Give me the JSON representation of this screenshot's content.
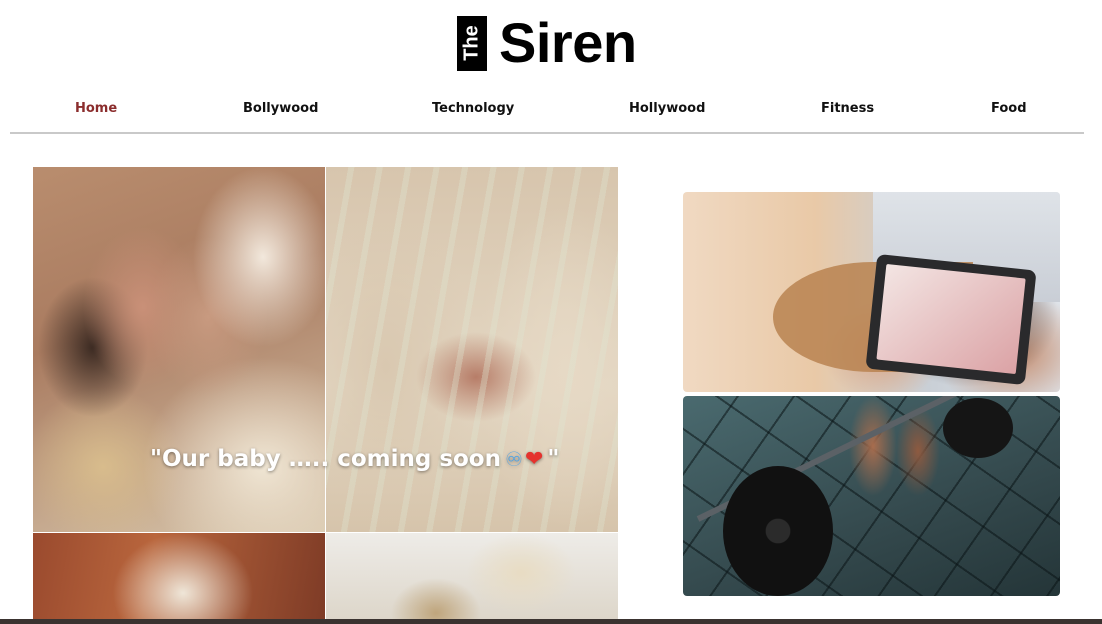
{
  "site": {
    "logo_badge": "The",
    "logo_text": "Siren",
    "accent_color": "#8b2d2d"
  },
  "nav": {
    "items": [
      {
        "label": "Home",
        "active": true
      },
      {
        "label": "Bollywood",
        "active": false
      },
      {
        "label": "Technology",
        "active": false
      },
      {
        "label": "Hollywood",
        "active": false
      },
      {
        "label": "Fitness",
        "active": false
      },
      {
        "label": "Food",
        "active": false
      }
    ]
  },
  "hero": {
    "caption_open": "\"Our baby ….. coming soon",
    "caption_emoji_infinity": "♾",
    "caption_emoji_heart": "❤",
    "caption_close": "\""
  },
  "cards": {
    "tech_image_icon": "tablet-photo",
    "fitness_image_icon": "barbell-photo"
  }
}
